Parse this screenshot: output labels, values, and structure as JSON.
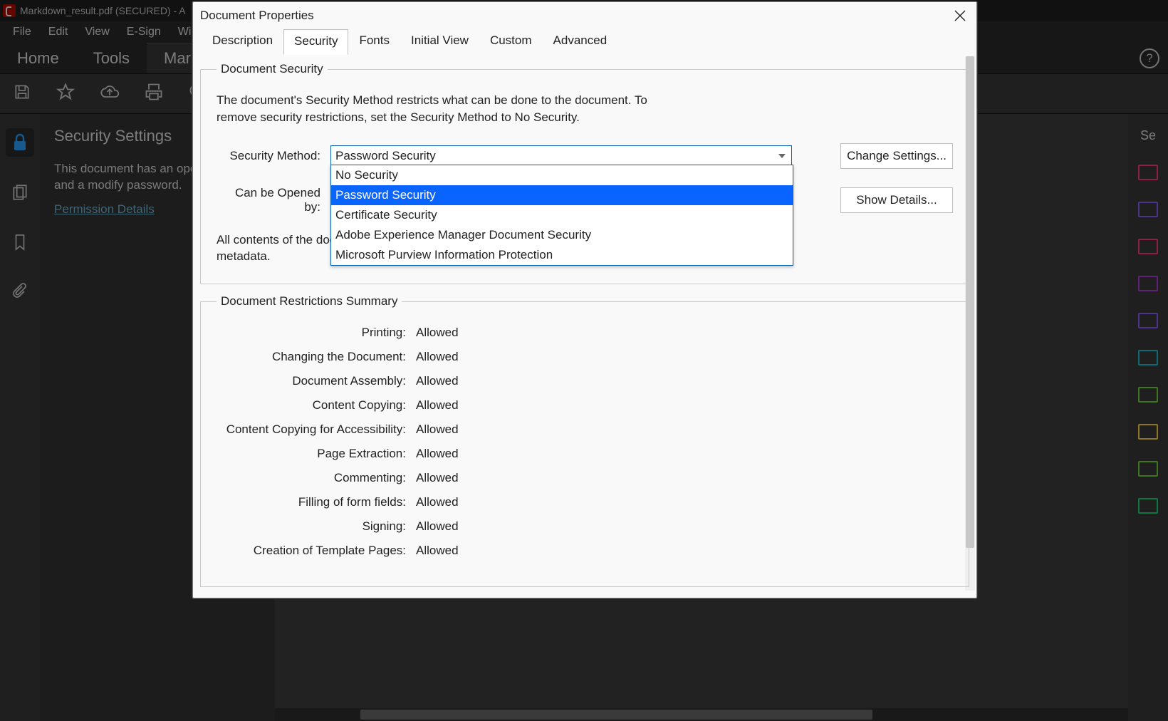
{
  "window": {
    "title": "Markdown_result.pdf (SECURED) - A"
  },
  "menubar": [
    "File",
    "Edit",
    "View",
    "E-Sign",
    "Window"
  ],
  "maintabs": {
    "home": "Home",
    "tools": "Tools",
    "doc": "Markd"
  },
  "leftPanel": {
    "title": "Security Settings",
    "text": "This document has an open password and a modify password.",
    "link": "Permission Details"
  },
  "rightRail": {
    "search": "Se"
  },
  "help": "?",
  "dialog": {
    "title": "Document Properties",
    "tabs": [
      "Description",
      "Security",
      "Fonts",
      "Initial View",
      "Custom",
      "Advanced"
    ],
    "activeTab": 1,
    "security": {
      "group": "Document Security",
      "desc": "The document's Security Method restricts what can be done to the document. To remove security restrictions, set the Security Method to No Security.",
      "methodLabel": "Security Method:",
      "methodValue": "Password Security",
      "options": [
        "No Security",
        "Password Security",
        "Certificate Security",
        "Adobe Experience Manager Document Security",
        "Microsoft Purview Information Protection"
      ],
      "selectedOption": 1,
      "changeBtn": "Change Settings...",
      "openedLabel": "Can be Opened by:",
      "showBtn": "Show Details...",
      "encryptNote": "All contents of the document are encrypted and search engines cannot access the document's metadata."
    },
    "restrictions": {
      "group": "Document Restrictions Summary",
      "rows": [
        {
          "k": "Printing:",
          "v": "Allowed"
        },
        {
          "k": "Changing the Document:",
          "v": "Allowed"
        },
        {
          "k": "Document Assembly:",
          "v": "Allowed"
        },
        {
          "k": "Content Copying:",
          "v": "Allowed"
        },
        {
          "k": "Content Copying for Accessibility:",
          "v": "Allowed"
        },
        {
          "k": "Page Extraction:",
          "v": "Allowed"
        },
        {
          "k": "Commenting:",
          "v": "Allowed"
        },
        {
          "k": "Filling of form fields:",
          "v": "Allowed"
        },
        {
          "k": "Signing:",
          "v": "Allowed"
        },
        {
          "k": "Creation of Template Pages:",
          "v": "Allowed"
        }
      ]
    }
  }
}
